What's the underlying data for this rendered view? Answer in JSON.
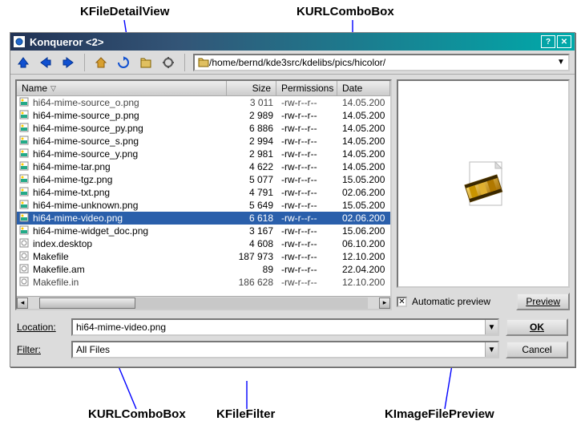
{
  "annotations": {
    "top_left": "KFileDetailView",
    "top_right": "KURLComboBox",
    "bottom_1": "KURLComboBox",
    "bottom_2": "KFileFilter",
    "bottom_3": "KImageFilePreview"
  },
  "window": {
    "title": "Konqueror <2>"
  },
  "toolbar": {
    "url": "/home/bernd/kde3src/kdelibs/pics/hicolor/"
  },
  "columns": {
    "name": "Name",
    "size": "Size",
    "perm": "Permissions",
    "date": "Date"
  },
  "files": [
    {
      "name": "hi64-mime-source_o.png",
      "size": "3 011",
      "perm": "-rw-r--r--",
      "date": "14.05.200",
      "dim": true
    },
    {
      "name": "hi64-mime-source_p.png",
      "size": "2 989",
      "perm": "-rw-r--r--",
      "date": "14.05.200"
    },
    {
      "name": "hi64-mime-source_py.png",
      "size": "6 886",
      "perm": "-rw-r--r--",
      "date": "14.05.200"
    },
    {
      "name": "hi64-mime-source_s.png",
      "size": "2 994",
      "perm": "-rw-r--r--",
      "date": "14.05.200"
    },
    {
      "name": "hi64-mime-source_y.png",
      "size": "2 981",
      "perm": "-rw-r--r--",
      "date": "14.05.200"
    },
    {
      "name": "hi64-mime-tar.png",
      "size": "4 622",
      "perm": "-rw-r--r--",
      "date": "14.05.200"
    },
    {
      "name": "hi64-mime-tgz.png",
      "size": "5 077",
      "perm": "-rw-r--r--",
      "date": "15.05.200"
    },
    {
      "name": "hi64-mime-txt.png",
      "size": "4 791",
      "perm": "-rw-r--r--",
      "date": "02.06.200"
    },
    {
      "name": "hi64-mime-unknown.png",
      "size": "5 649",
      "perm": "-rw-r--r--",
      "date": "15.05.200"
    },
    {
      "name": "hi64-mime-video.png",
      "size": "6 618",
      "perm": "-rw-r--r--",
      "date": "02.06.200",
      "sel": true
    },
    {
      "name": "hi64-mime-widget_doc.png",
      "size": "3 167",
      "perm": "-rw-r--r--",
      "date": "15.06.200"
    },
    {
      "name": "index.desktop",
      "size": "4 608",
      "perm": "-rw-r--r--",
      "date": "06.10.200"
    },
    {
      "name": "Makefile",
      "size": "187 973",
      "perm": "-rw-r--r--",
      "date": "12.10.200"
    },
    {
      "name": "Makefile.am",
      "size": "89",
      "perm": "-rw-r--r--",
      "date": "22.04.200"
    },
    {
      "name": "Makefile.in",
      "size": "186 628",
      "perm": "-rw-r--r--",
      "date": "12.10.200",
      "dim": true
    }
  ],
  "preview": {
    "auto_label": "Automatic preview",
    "button": "Preview"
  },
  "bottom": {
    "location_label": "Location:",
    "location_value": "hi64-mime-video.png",
    "filter_label": "Filter:",
    "filter_value": "All Files",
    "ok": "OK",
    "cancel": "Cancel"
  }
}
